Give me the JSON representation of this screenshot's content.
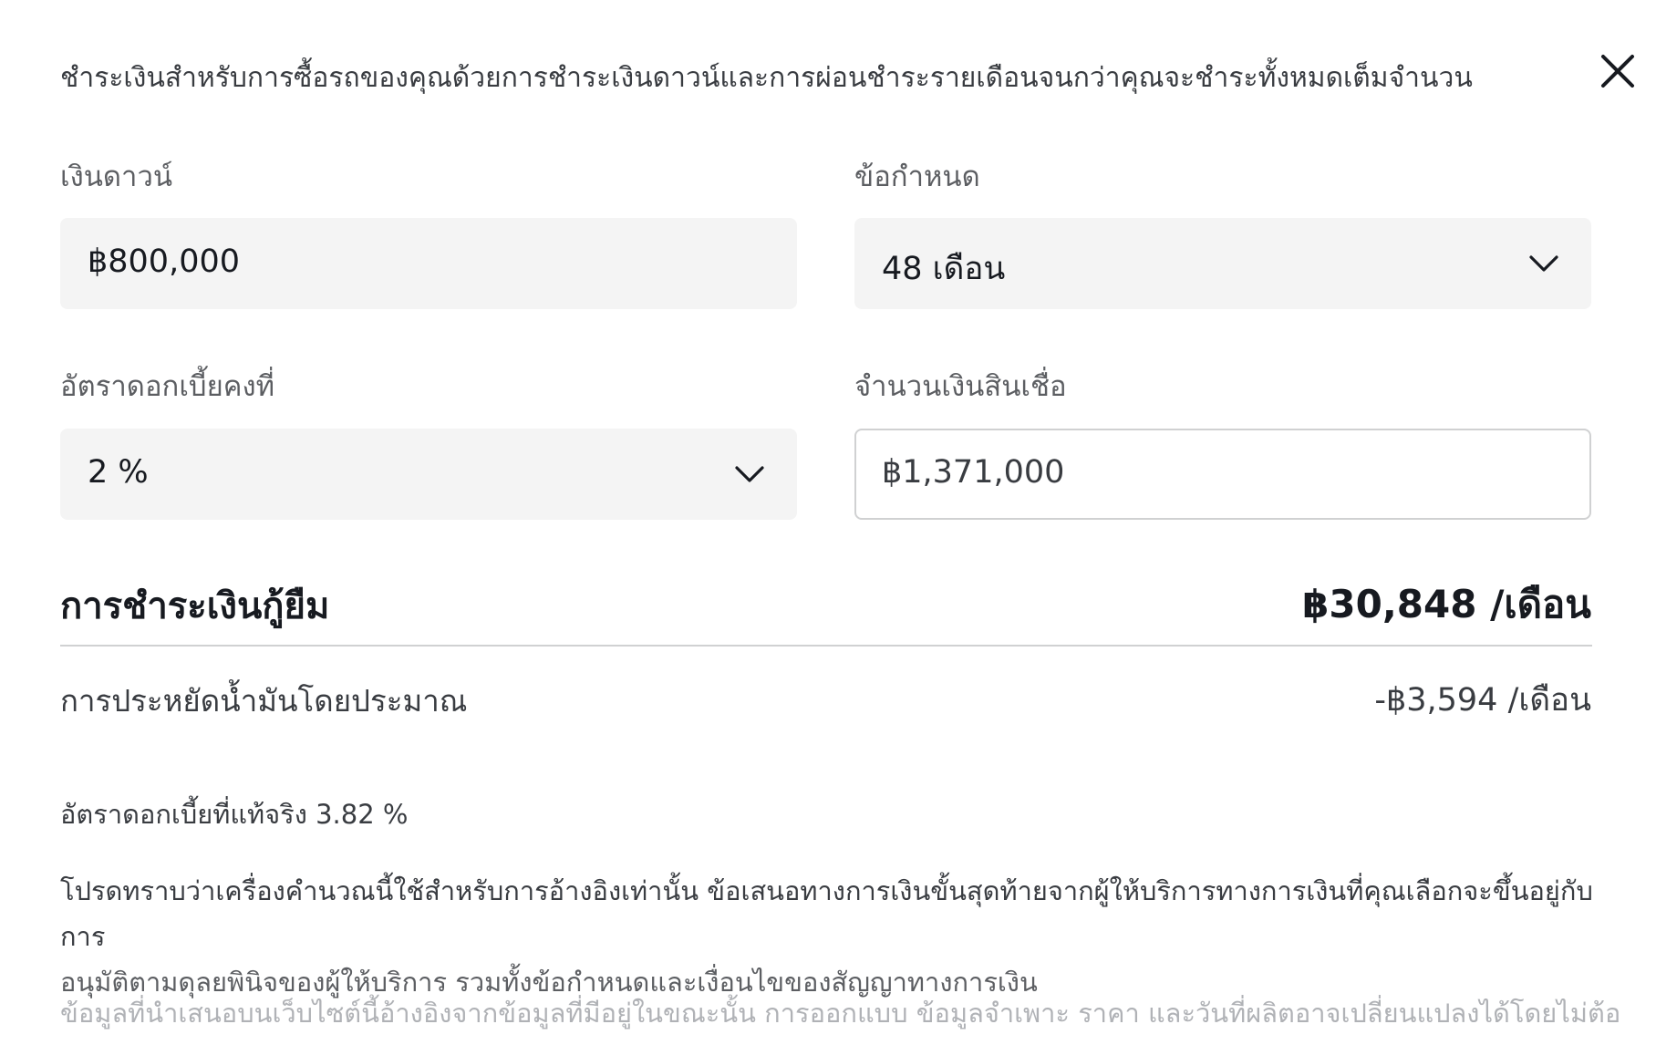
{
  "intro_text": "ชำระเงินสำหรับการซื้อรถของคุณด้วยการชำระเงินดาวน์และการผ่อนชำระรายเดือนจนกว่าคุณจะชำระทั้งหมดเต็มจำนวน",
  "close_icon": "close-icon",
  "fields": {
    "down_payment": {
      "label": "เงินดาวน์",
      "value": "฿800,000"
    },
    "term": {
      "label": "ข้อกำหนด",
      "value": "48 เดือน",
      "icon": "chevron-down-icon"
    },
    "interest_rate": {
      "label": "อัตราดอกเบี้ยคงที่",
      "value": "2 %",
      "icon": "chevron-down-icon"
    },
    "loan_amount": {
      "label": "จำนวนเงินสินเชื่อ",
      "value": "฿1,371,000"
    }
  },
  "loan_payment": {
    "label": "การชำระเงินกู้ยืม",
    "value": "฿30,848 /เดือน"
  },
  "fuel_savings": {
    "label": "การประหยัดน้ำมันโดยประมาณ",
    "value": "-฿3,594 /เดือน"
  },
  "effective_rate": "อัตราดอกเบี้ยที่แท้จริง 3.82 %",
  "disclaimer": {
    "line1": "โปรดทราบว่าเครื่องคำนวณนี้ใช้สำหรับการอ้างอิงเท่านั้น ข้อเสนอทางการเงินขั้นสุดท้ายจากผู้ให้บริการทางการเงินที่คุณเลือกจะขึ้นอยู่กับการ",
    "line2": "อนุมัติตามดุลยพินิจของผู้ให้บริการ รวมทั้งข้อกำหนดและเงื่อนไขของสัญญาทางการเงิน"
  },
  "fineprint": "ข้อมูลที่นำเสนอบนเว็บไซต์นี้อ้างอิงจากข้อมูลที่มีอยู่ในขณะนั้น การออกแบบ ข้อมูลจำเพาะ ราคา และวันที่ผลิตอาจเปลี่ยนแปลงได้โดยไม่ต้องแจ้งให้",
  "colors": {
    "text_primary": "#171a20",
    "text_secondary": "#393c41",
    "field_bg": "#f4f4f4",
    "border": "#d0d1d2"
  }
}
